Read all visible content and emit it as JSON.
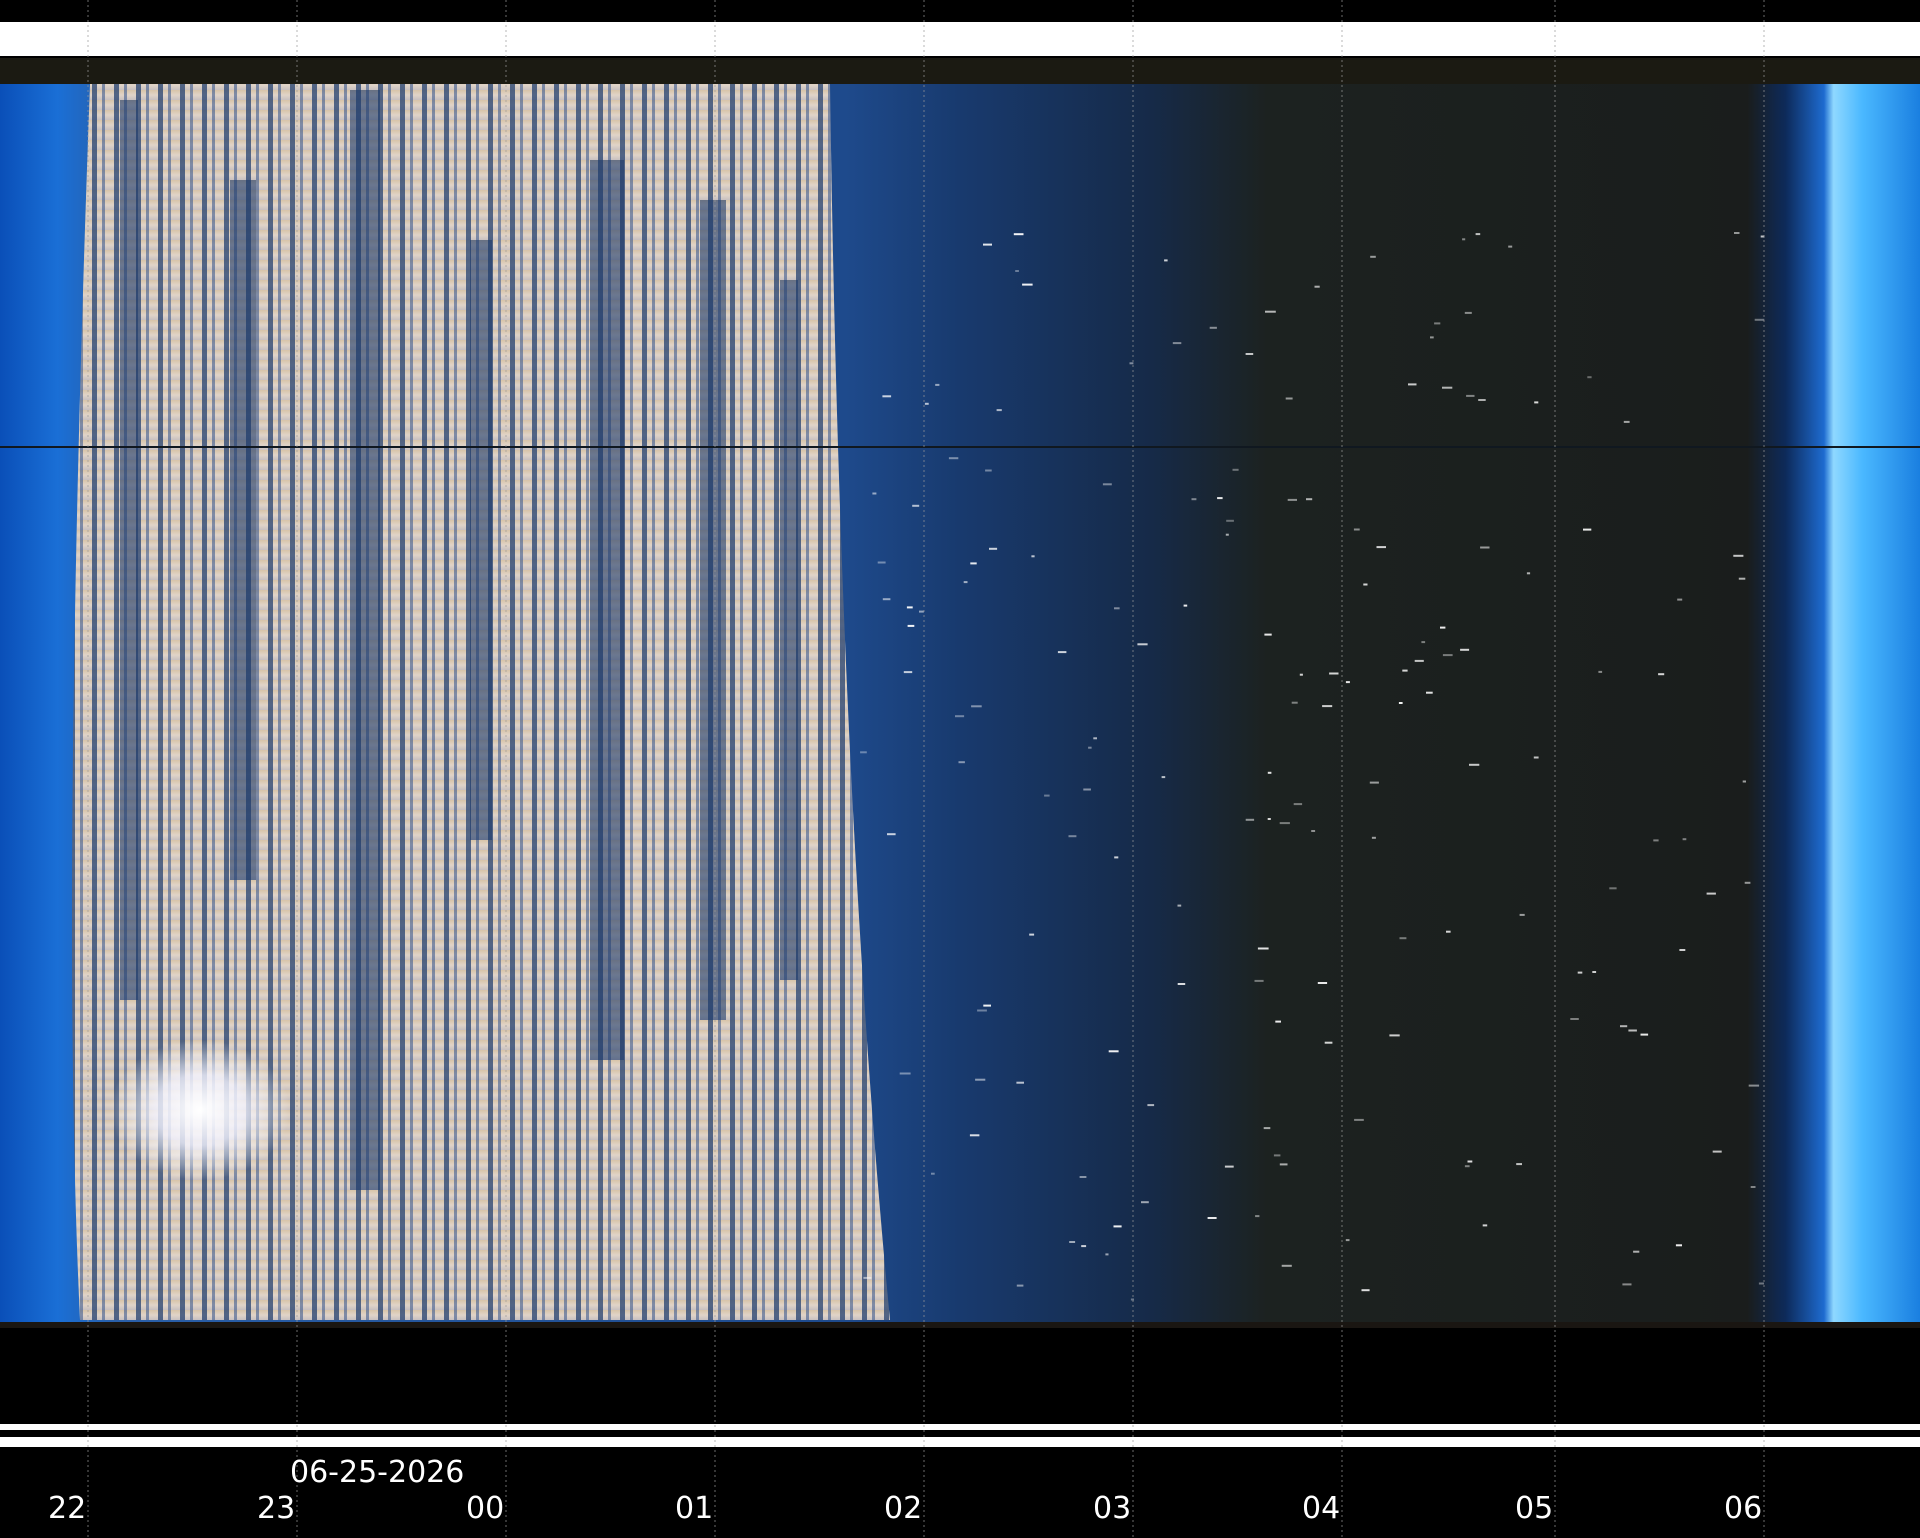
{
  "date_label": "06-25-2026",
  "hour_labels": [
    "22",
    "23",
    "00",
    "01",
    "02",
    "03",
    "04",
    "05",
    "06"
  ],
  "colors": {
    "background": "#000000",
    "day_sky": "#1a6fd6",
    "twilight_blue": "#1d3f7a",
    "night_sky": "#1c1f1c",
    "cloud": "#e8d8c4",
    "dawn_cyan": "#3fb4ff",
    "label": "#ffffff"
  }
}
